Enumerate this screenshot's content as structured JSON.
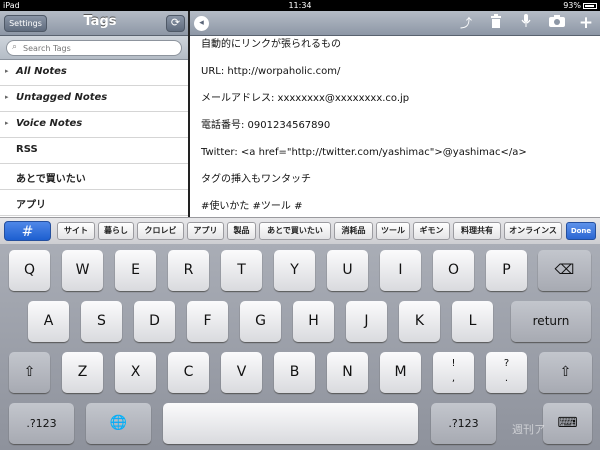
{
  "status_bar": {
    "carrier": "iPad",
    "time": "11:34",
    "battery": "93%",
    "battery_level": 0.93
  },
  "sidebar": {
    "settings_label": "Settings",
    "title": "Tags",
    "refresh_icon": "refresh-icon",
    "search_placeholder": "Search Tags",
    "items": [
      {
        "label": "All Notes",
        "italic": true,
        "disclosure": true
      },
      {
        "label": "Untagged Notes",
        "italic": true,
        "disclosure": true
      },
      {
        "label": "Voice Notes",
        "italic": true,
        "disclosure": true
      },
      {
        "label": "RSS",
        "italic": false,
        "disclosure": false
      },
      {
        "label": "あとで買いたい",
        "italic": false,
        "disclosure": false
      },
      {
        "label": "アプリ",
        "italic": false,
        "disclosure": false
      }
    ]
  },
  "editor": {
    "toolbar_icons": [
      "back-icon",
      "share-icon",
      "trash-icon",
      "microphone-icon",
      "camera-icon",
      "plus-icon"
    ],
    "lines": [
      "自動的にリンクが張られるもの",
      "URL: http://worpaholic.com/",
      "メールアドレス: xxxxxxxx@xxxxxxxx.co.jp",
      "電話番号: 0901234567890",
      "Twitter: <a href=\"http://twitter.com/yashimac\">@yashimac</a>",
      "タグの挿入もワンタッチ",
      "#使いかた #ツール #"
    ]
  },
  "tag_bar": {
    "hash_label": "#",
    "tags": [
      "サイト",
      "暮らし",
      "クロレビ",
      "アプリ",
      "製品",
      "あとで買いたい",
      "消耗品",
      "ツール",
      "ギモン",
      "料理共有",
      "オンラインス"
    ],
    "done_label": "Done"
  },
  "keyboard": {
    "row1": [
      "Q",
      "W",
      "E",
      "R",
      "T",
      "Y",
      "U",
      "I",
      "O",
      "P"
    ],
    "row2": [
      "A",
      "S",
      "D",
      "F",
      "G",
      "H",
      "J",
      "K",
      "L"
    ],
    "return_label": "return",
    "row3": [
      "Z",
      "X",
      "C",
      "V",
      "B",
      "N",
      "M"
    ],
    "punct": [
      {
        "top": "!",
        "bottom": ","
      },
      {
        "top": "?",
        "bottom": "."
      }
    ],
    "numbers_label": ".?123",
    "backspace_icon": "backspace-icon",
    "shift_icon": "shift-icon",
    "globe_icon": "globe-icon",
    "dismiss_icon": "keyboard-dismiss-icon"
  },
  "watermark": "週刊ア"
}
